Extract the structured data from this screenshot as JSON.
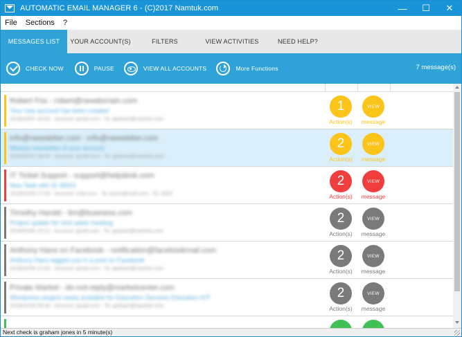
{
  "window": {
    "title": "AUTOMATIC EMAIL MANAGER 6 - (C)2017 Namtuk.com",
    "controls": {
      "minimize": "—",
      "maximize": "☐",
      "close": "✕"
    }
  },
  "menu": [
    {
      "label": "File"
    },
    {
      "label": "Sections"
    },
    {
      "label": "?"
    }
  ],
  "tabs": [
    {
      "label": "MESSAGES LIST",
      "active": true
    },
    {
      "label": "YOUR ACCOUNT(S)"
    },
    {
      "label": "FILTERS"
    },
    {
      "label": "VIEW ACTIVITIES"
    },
    {
      "label": "NEED HELP?"
    }
  ],
  "toolbar": {
    "check_now": "CHECK NOW",
    "pause": "PAUSE",
    "view_all_accounts": "VIEW ALL ACCOUNTS",
    "more_functions": "More Functions",
    "message_count": "7 message(s)"
  },
  "colors": {
    "accent": "#2fa3d7",
    "titlebar": "#1994d8",
    "yellow": "#fcc419",
    "red": "#f03e3e",
    "gray": "#7a7a7a",
    "green": "#40c057"
  },
  "messages": [
    {
      "status_color": "#fcc419",
      "action_count": "1",
      "action_label": "Action(s)",
      "view_text": "VIEW",
      "view_label": "message",
      "sender": "Robert Fox - robert@newdomain.com",
      "subject": "Your new account has been created",
      "meta": "2018/02/07 10:02 - Account: gmail.com - To: graham@namtuk.com"
    },
    {
      "status_color": "#fcc419",
      "action_count": "2",
      "action_label": "Action(s)",
      "view_text": "VIEW",
      "view_label": "message",
      "selected": true,
      "sender": "info@newsletter.com - info@newsletter.com",
      "subject": "Weekly newsletter of your account",
      "meta": "2018/02/07 09:40 - Account: gmail.com - To: graham@namtuk.com"
    },
    {
      "status_color": "#f03e3e",
      "action_count": "2",
      "action_label": "Action(s)",
      "view_text": "VIEW",
      "view_label": "message",
      "sender": "IT Ticket Support - support@helpdesk.com",
      "subject": "New Task with ID 38201",
      "meta": "2018/02/06 17:20 - Account: mail.com - To: jones@mail.com - ID: 3820"
    },
    {
      "status_color": "#7a7a7a",
      "action_count": "2",
      "action_label": "Action(s)",
      "view_text": "VIEW",
      "view_label": "message",
      "sender": "Timothy Harold - tim@business.com",
      "subject": "Project update for next week meeting",
      "meta": "2018/02/06 15:11 - Account: gmail.com - To: graham@namtuk.com"
    },
    {
      "status_color": "#7a7a7a",
      "action_count": "2",
      "action_label": "Action(s)",
      "view_text": "VIEW",
      "view_label": "message",
      "sender": "Anthony Hans on Facebook - notification@facebookmail.com",
      "subject": "Anthony Hans tagged you in a post on Facebook",
      "meta": "2018/02/06 12:02 - Account: gmail.com - To: graham@namtuk.com"
    },
    {
      "status_color": "#7a7a7a",
      "action_count": "2",
      "action_label": "Action(s)",
      "view_text": "VIEW",
      "view_label": "message",
      "sender": "Private Market - do-not-reply@marketcenter.com",
      "subject": "Wordpress plugins newly available for Education Services Education KIT",
      "meta": "2018/02/06 09:30 - Account: gmail.com - To: graham@namtuk.com"
    },
    {
      "status_color": "#40c057",
      "action_count": "",
      "action_label": "",
      "view_text": "",
      "view_label": "",
      "sender": "",
      "subject": "",
      "meta": ""
    }
  ],
  "status": {
    "text": "Next check is graham jones in 5 minute(s)"
  }
}
